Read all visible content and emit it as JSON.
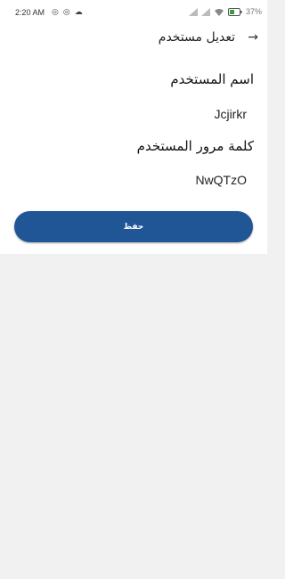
{
  "status_bar": {
    "time": "2:20 AM",
    "battery": "37"
  },
  "header": {
    "title": "تعديل مستخدم"
  },
  "form": {
    "username_label": "اسم المستخدم",
    "username_value": "Jcjirkr",
    "password_label": "كلمة مرور المستخدم",
    "password_value": "NwQTzO"
  },
  "save_button": {
    "label": "حفظ",
    "color": "#205596"
  },
  "colors": {
    "background": "#f1f1f1",
    "surface": "#ffffff"
  }
}
